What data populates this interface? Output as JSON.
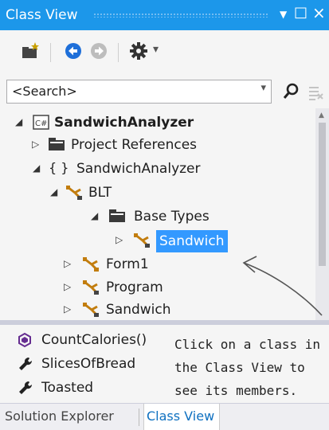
{
  "window": {
    "title": "Class View"
  },
  "titlebar_buttons": {
    "dropdown": "▼",
    "maximize": "□",
    "close": "×"
  },
  "toolbar": {
    "new_folder_icon": "new-folder-icon",
    "back_icon": "back-arrow-icon",
    "forward_icon": "forward-arrow-icon",
    "settings_icon": "gear-icon",
    "settings_dropdown": "▾"
  },
  "search": {
    "value": "<Search>"
  },
  "tree": {
    "items": [
      {
        "label": "SandwichAnalyzer",
        "expanded": true,
        "icon": "csharp-project-icon",
        "level": 0
      },
      {
        "label": "Project References",
        "expanded": false,
        "icon": "folder-icon",
        "level": 1
      },
      {
        "label": "SandwichAnalyzer",
        "expanded": true,
        "icon": "namespace-braces-icon",
        "level": 1
      },
      {
        "label": "BLT",
        "expanded": true,
        "icon": "class-icon",
        "level": 2
      },
      {
        "label": "Base Types",
        "expanded": true,
        "icon": "folder-icon",
        "level": 3
      },
      {
        "label": "Sandwich",
        "expanded": false,
        "icon": "class-icon",
        "level": 4,
        "selected": true
      },
      {
        "label": "Form1",
        "expanded": false,
        "icon": "class-icon",
        "level": 2
      },
      {
        "label": "Program",
        "expanded": false,
        "icon": "class-icon",
        "level": 2
      },
      {
        "label": "Sandwich",
        "expanded": false,
        "icon": "class-icon",
        "level": 2
      }
    ]
  },
  "members": {
    "items": [
      {
        "label": "CountCalories()",
        "icon": "method-icon"
      },
      {
        "label": "SlicesOfBread",
        "icon": "property-wrench-icon"
      },
      {
        "label": "Toasted",
        "icon": "property-wrench-icon"
      }
    ]
  },
  "annotation": {
    "line1": "Click on a class in",
    "line2": "the Class View to",
    "line3": "see its members."
  },
  "tabs": [
    {
      "label": "Solution Explorer",
      "active": false
    },
    {
      "label": "Class View",
      "active": true
    }
  ],
  "colors": {
    "titlebar": "#1c97ea",
    "selection": "#3399ff",
    "class_icon": "#c27d0e",
    "method_icon": "#652d90",
    "active_tab_text": "#0e70c0"
  }
}
